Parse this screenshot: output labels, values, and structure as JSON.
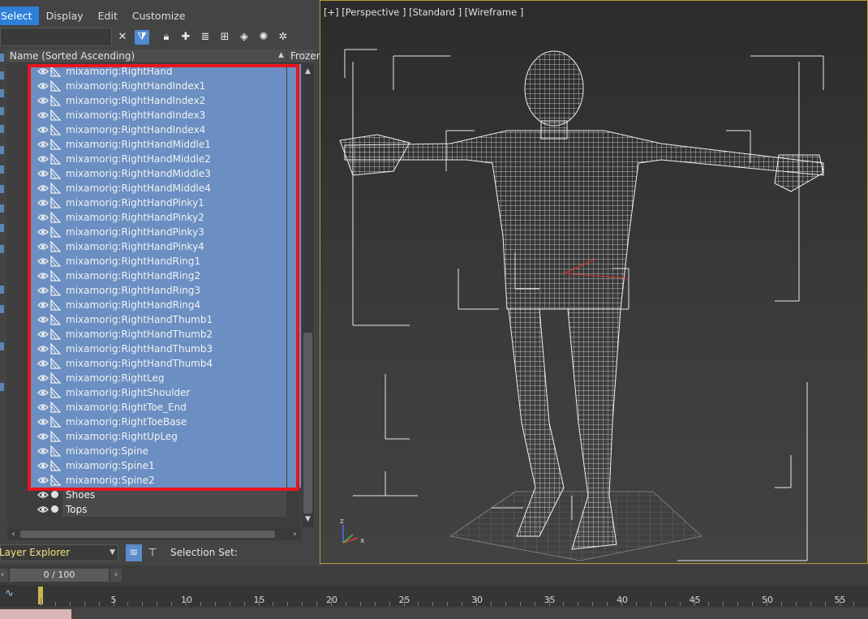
{
  "menu": {
    "items": [
      {
        "label": "Select",
        "active": true
      },
      {
        "label": "Display",
        "active": false
      },
      {
        "label": "Edit",
        "active": false
      },
      {
        "label": "Customize",
        "active": false
      }
    ]
  },
  "toolbar": {
    "search_value": "",
    "icons": [
      "close-icon",
      "filter-icon",
      "lock-icon",
      "add-icon",
      "layer-stack-icon",
      "hierarchy-icon",
      "layers-icon",
      "light-icon",
      "bone-filter-icon"
    ]
  },
  "explorer": {
    "column_name": "Name (Sorted Ascending)",
    "column_frozen": "Frozen",
    "rows": [
      {
        "label": "mixamorig:RightHand",
        "type": "bone",
        "selected": true
      },
      {
        "label": "mixamorig:RightHandIndex1",
        "type": "bone",
        "selected": true
      },
      {
        "label": "mixamorig:RightHandIndex2",
        "type": "bone",
        "selected": true
      },
      {
        "label": "mixamorig:RightHandIndex3",
        "type": "bone",
        "selected": true
      },
      {
        "label": "mixamorig:RightHandIndex4",
        "type": "bone",
        "selected": true
      },
      {
        "label": "mixamorig:RightHandMiddle1",
        "type": "bone",
        "selected": true
      },
      {
        "label": "mixamorig:RightHandMiddle2",
        "type": "bone",
        "selected": true
      },
      {
        "label": "mixamorig:RightHandMiddle3",
        "type": "bone",
        "selected": true
      },
      {
        "label": "mixamorig:RightHandMiddle4",
        "type": "bone",
        "selected": true
      },
      {
        "label": "mixamorig:RightHandPinky1",
        "type": "bone",
        "selected": true
      },
      {
        "label": "mixamorig:RightHandPinky2",
        "type": "bone",
        "selected": true
      },
      {
        "label": "mixamorig:RightHandPinky3",
        "type": "bone",
        "selected": true
      },
      {
        "label": "mixamorig:RightHandPinky4",
        "type": "bone",
        "selected": true
      },
      {
        "label": "mixamorig:RightHandRing1",
        "type": "bone",
        "selected": true
      },
      {
        "label": "mixamorig:RightHandRing2",
        "type": "bone",
        "selected": true
      },
      {
        "label": "mixamorig:RightHandRing3",
        "type": "bone",
        "selected": true
      },
      {
        "label": "mixamorig:RightHandRing4",
        "type": "bone",
        "selected": true
      },
      {
        "label": "mixamorig:RightHandThumb1",
        "type": "bone",
        "selected": true
      },
      {
        "label": "mixamorig:RightHandThumb2",
        "type": "bone",
        "selected": true
      },
      {
        "label": "mixamorig:RightHandThumb3",
        "type": "bone",
        "selected": true
      },
      {
        "label": "mixamorig:RightHandThumb4",
        "type": "bone",
        "selected": true
      },
      {
        "label": "mixamorig:RightLeg",
        "type": "bone",
        "selected": true
      },
      {
        "label": "mixamorig:RightShoulder",
        "type": "bone",
        "selected": true
      },
      {
        "label": "mixamorig:RightToe_End",
        "type": "bone",
        "selected": true
      },
      {
        "label": "mixamorig:RightToeBase",
        "type": "bone",
        "selected": true
      },
      {
        "label": "mixamorig:RightUpLeg",
        "type": "bone",
        "selected": true
      },
      {
        "label": "mixamorig:Spine",
        "type": "bone",
        "selected": true
      },
      {
        "label": "mixamorig:Spine1",
        "type": "bone",
        "selected": true
      },
      {
        "label": "mixamorig:Spine2",
        "type": "bone",
        "selected": true
      },
      {
        "label": "Shoes",
        "type": "mesh",
        "selected": false
      },
      {
        "label": "Tops",
        "type": "mesh",
        "selected": false
      }
    ]
  },
  "bottom_bar": {
    "layer_dropdown_value": "Layer Explorer",
    "selection_set_label": "Selection Set:"
  },
  "viewport": {
    "label": "[+] [Perspective ] [Standard ] [Wireframe ]",
    "axis_labels": {
      "z": "z",
      "x": "x"
    }
  },
  "timeline": {
    "frame_display": "0 / 100",
    "ticks": [
      "5",
      "10",
      "15",
      "20",
      "25",
      "30",
      "35",
      "40",
      "45",
      "50",
      "55"
    ]
  },
  "colors": {
    "selection_highlight": "#6b8fc2",
    "annotation_box": "#e8141e",
    "active_menu": "#2e7fd9",
    "viewport_border": "#b49a3c",
    "layer_label": "#f6e27a"
  }
}
